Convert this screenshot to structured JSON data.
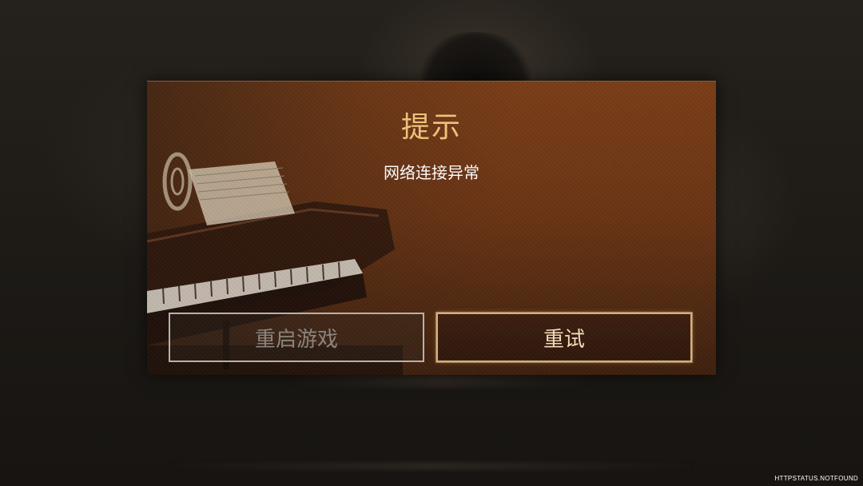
{
  "dialog": {
    "title": "提示",
    "message": "网络连接异常",
    "buttons": {
      "restart_label": "重启游戏",
      "retry_label": "重试"
    }
  },
  "watermark": "HTTPSTATUS.NOTFOUND",
  "colors": {
    "title": "#f1c47d",
    "dialog_bg": "#6a3414",
    "retry_border": "#d8b07a",
    "restart_border": "#bdb3aa"
  }
}
